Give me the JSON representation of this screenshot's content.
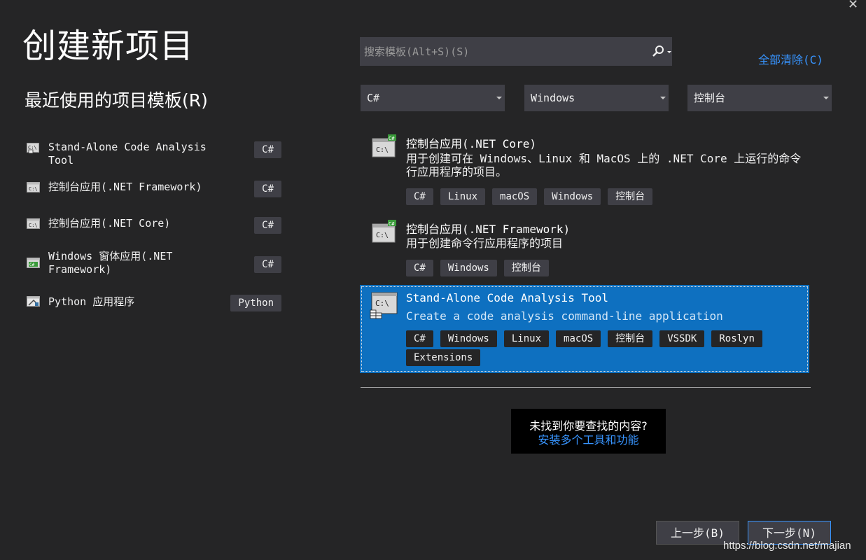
{
  "header": {
    "title": "创建新项目",
    "close_glyph": "✕"
  },
  "recent": {
    "title": "最近使用的项目模板(R)",
    "items": [
      {
        "label": "Stand-Alone Code Analysis\nTool",
        "tag": "C#",
        "icon": "analysis-tool-icon"
      },
      {
        "label": "控制台应用(.NET Framework)",
        "tag": "C#",
        "icon": "console-app-icon"
      },
      {
        "label": "控制台应用(.NET Core)",
        "tag": "C#",
        "icon": "console-app-icon"
      },
      {
        "label": "Windows 窗体应用(.NET\nFramework)",
        "tag": "C#",
        "icon": "windows-forms-icon"
      },
      {
        "label": "Python 应用程序",
        "tag": "Python",
        "icon": "python-app-icon"
      }
    ]
  },
  "search": {
    "placeholder": "搜索模板(Alt+S)(S)",
    "clear_all": "全部清除(C)"
  },
  "filters": {
    "language": "C#",
    "platform": "Windows",
    "project_type": "控制台"
  },
  "templates": [
    {
      "name": "控制台应用(.NET Core)",
      "description": "用于创建可在 Windows、Linux 和 MacOS 上的 .NET Core 上运行的命令行应用程序的项目。",
      "tags": [
        "C#",
        "Linux",
        "macOS",
        "Windows",
        "控制台"
      ]
    },
    {
      "name": "控制台应用(.NET Framework)",
      "description": "用于创建命令行应用程序的项目",
      "tags": [
        "C#",
        "Windows",
        "控制台"
      ]
    },
    {
      "name": "Stand-Alone Code Analysis Tool",
      "description": "Create a code analysis command-line application",
      "tags": [
        "C#",
        "Windows",
        "Linux",
        "macOS",
        "控制台",
        "VSSDK",
        "Roslyn",
        "Extensions"
      ],
      "selected": true
    }
  ],
  "not_found": {
    "question": "未找到你要查找的内容?",
    "link": "安装多个工具和功能"
  },
  "buttons": {
    "back": "上一步(B)",
    "next": "下一步(N)"
  },
  "watermark": "https://blog.csdn.net/majian",
  "colors": {
    "background": "#252526",
    "selection": "#0e70c0",
    "link": "#3794ff",
    "control": "#3f3f46"
  }
}
